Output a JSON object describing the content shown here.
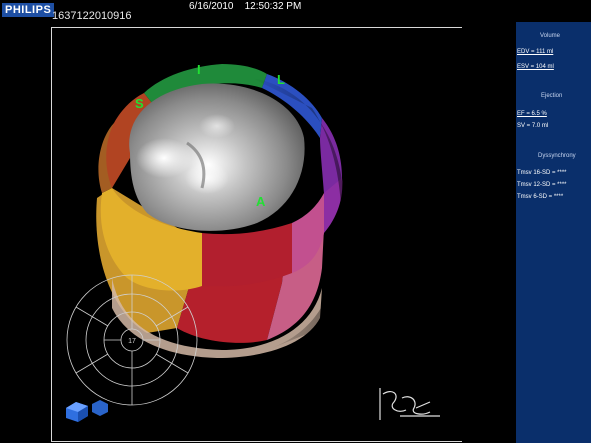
{
  "header": {
    "brand": "PHILIPS",
    "patient_id": "1637122010916",
    "datetime": "6/16/2010    12:50:32 PM"
  },
  "viewport": {
    "segment_labels": {
      "inferior": "I",
      "lateral": "L",
      "septal": "S",
      "anterior": "A"
    },
    "bullseye_center": "17",
    "icons": [
      "rotate-cube-icon",
      "orientation-glyph-icon"
    ],
    "segment_colors": {
      "inferior": "#1f8a3a",
      "lateral": "#2b4fc0",
      "posterior": "#9a2fa8",
      "anterior": "#b21f2e",
      "septal": "#a05a1c",
      "anteroseptal": "#e1b62c",
      "apex": "#9a9a9a"
    }
  },
  "panel": {
    "volume_title": "Volume",
    "edv": "EDV = 111 ml",
    "esv": "ESV = 104 ml",
    "ejection_title": "Ejection",
    "ef": "EF = 6.5 %",
    "sv": "SV = 7.0 ml",
    "dyssync_title": "Dyssynchrony",
    "tmsv16": "Tmsv 16-SD = ****",
    "tmsv12": "Tmsv 12-SD = ****",
    "tmsv6": "Tmsv 6-SD = ****"
  }
}
